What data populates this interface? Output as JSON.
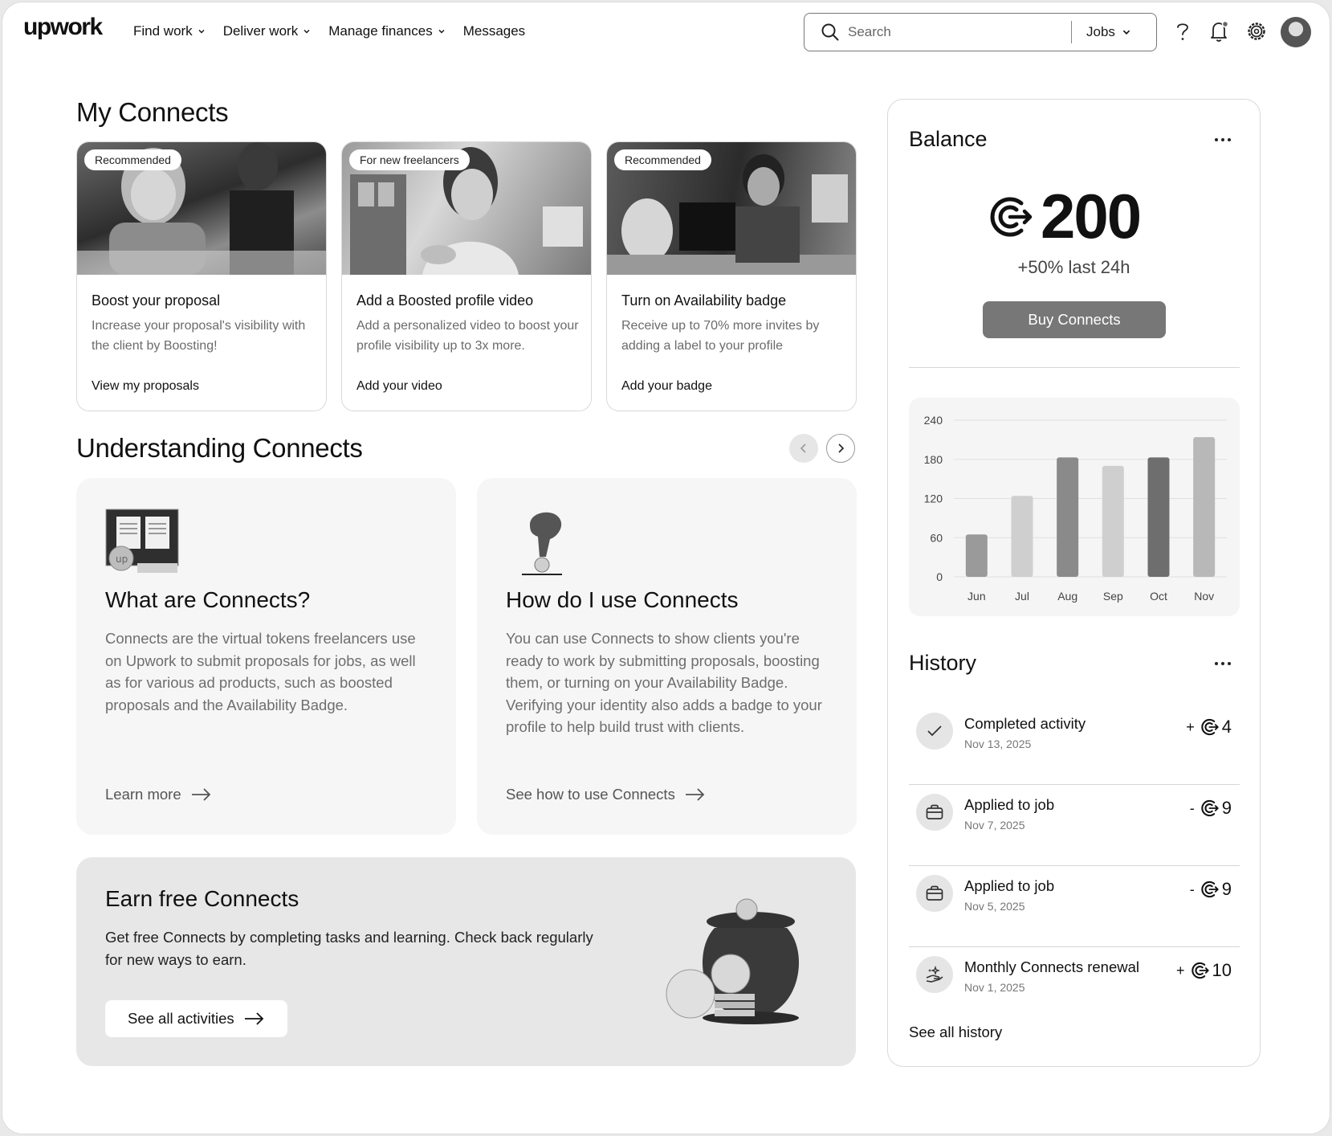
{
  "header": {
    "logo": "upwork",
    "nav": [
      {
        "label": "Find work",
        "dropdown": true
      },
      {
        "label": "Deliver work",
        "dropdown": true
      },
      {
        "label": "Manage finances",
        "dropdown": true
      },
      {
        "label": "Messages",
        "dropdown": false
      }
    ],
    "search": {
      "placeholder": "Search",
      "scope": "Jobs"
    },
    "icons": [
      "help-icon",
      "notification-bell-icon",
      "settings-gear-icon",
      "avatar"
    ]
  },
  "my_connects": {
    "title": "My Connects",
    "cards": [
      {
        "badge": "Recommended",
        "title": "Boost your proposal",
        "desc": "Increase your proposal's visibility with the client by Boosting!",
        "link": "View my proposals"
      },
      {
        "badge": "For new freelancers",
        "title": "Add a Boosted profile video",
        "desc": "Add a personalized video to boost your profile visibility up to 3x more.",
        "link": "Add your video"
      },
      {
        "badge": "Recommended",
        "title": "Turn on Availability badge",
        "desc": "Receive up to 70% more invites by adding a label to your profile",
        "link": "Add your badge"
      }
    ]
  },
  "understanding": {
    "title": "Understanding Connects",
    "cards": [
      {
        "title": "What are Connects?",
        "desc": "Connects are the virtual tokens freelancers use on Upwork to submit proposals for jobs, as well as for various ad products, such as boosted proposals and the Availability Badge.",
        "link": "Learn more"
      },
      {
        "title": "How do I use Connects",
        "desc": "You can use Connects to show clients you're ready to work by submitting proposals, boosting them, or turning on your Availability Badge. Verifying your identity also adds a badge to your profile to help build trust with clients.",
        "link": "See how to use Connects"
      }
    ]
  },
  "earn": {
    "title": "Earn free Connects",
    "desc": "Get free Connects by completing tasks and learning. Check back regularly for new ways to earn.",
    "button": "See all activities"
  },
  "balance": {
    "title": "Balance",
    "amount": "200",
    "change": "+50% last 24h",
    "button": "Buy Connects"
  },
  "chart_data": {
    "type": "bar",
    "categories": [
      "Jun",
      "Jul",
      "Aug",
      "Sep",
      "Oct",
      "Nov"
    ],
    "values": [
      65,
      124,
      183,
      170,
      183,
      214
    ],
    "ylim": [
      0,
      240
    ],
    "yticks": [
      0,
      60,
      120,
      180,
      240
    ],
    "colors": [
      "#9a9a9a",
      "#cfcfcf",
      "#8a8a8a",
      "#cfcfcf",
      "#6e6e6e",
      "#b8b8b8"
    ],
    "title": "",
    "xlabel": "",
    "ylabel": "",
    "grid": true
  },
  "history": {
    "title": "History",
    "items": [
      {
        "icon": "check-icon",
        "title": "Completed activity",
        "date": "Nov 13, 2025",
        "sign": "+",
        "amount": "4"
      },
      {
        "icon": "briefcase-icon",
        "title": "Applied to job",
        "date": "Nov 7, 2025",
        "sign": "-",
        "amount": "9"
      },
      {
        "icon": "briefcase-icon",
        "title": "Applied to job",
        "date": "Nov 5, 2025",
        "sign": "-",
        "amount": "9"
      },
      {
        "icon": "sparkle-hand-icon",
        "title": "Monthly Connects renewal",
        "date": "Nov 1, 2025",
        "sign": "+",
        "amount": "10"
      }
    ],
    "see_all": "See all history"
  }
}
